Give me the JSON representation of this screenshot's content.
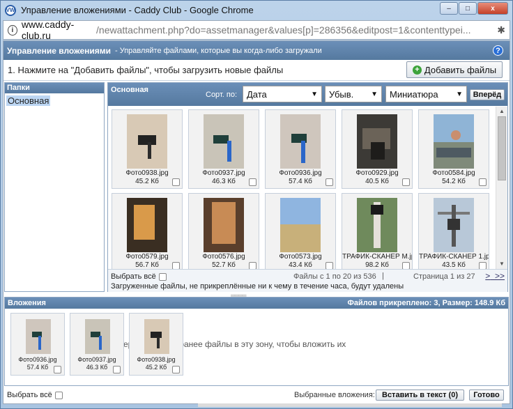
{
  "window": {
    "title": "Управление вложениями - Caddy Club - Google Chrome",
    "minimize": "–",
    "maximize": "□",
    "close": "x"
  },
  "address": {
    "host": "www.caddy-club.ru",
    "path": "/newattachment.php?do=assetmanager&values[p]=286356&editpost=1&contenttypei..."
  },
  "header": {
    "title": "Управление вложениями",
    "subtitle": "- Управляйте файлами, которые вы когда-либо загружали",
    "help": "?"
  },
  "instruction": "1. Нажмите на \"Добавить файлы\", чтобы загрузить новые файлы",
  "add_button": "Добавить файлы",
  "folders": {
    "heading": "Папки",
    "items": [
      "Основная"
    ]
  },
  "main": {
    "title": "Основная",
    "sort_label": "Сорт. по:",
    "sort_field": "Дата",
    "sort_order": "Убыв.",
    "view": "Миниатюра",
    "go": "Вперёд"
  },
  "files": [
    {
      "name": "Фото0938.jpg",
      "size": "45.2 Кб"
    },
    {
      "name": "Фото0937.jpg",
      "size": "46.3 Кб"
    },
    {
      "name": "Фото0936.jpg",
      "size": "57.4 Кб"
    },
    {
      "name": "Фото0929.jpg",
      "size": "40.5 Кб"
    },
    {
      "name": "Фото0584.jpg",
      "size": "54.2 Кб"
    },
    {
      "name": "Фото0579.jpg",
      "size": "56.7 Кб"
    },
    {
      "name": "Фото0576.jpg",
      "size": "52.7 Кб"
    },
    {
      "name": "Фото0573.jpg",
      "size": "43.4 Кб"
    },
    {
      "name": "ТРАФИК-СКАНЕР М.jp",
      "size": "98.2 Кб"
    },
    {
      "name": "ТРАФИК-СКАНЕР 1.jp",
      "size": "43.5 Кб"
    }
  ],
  "footer": {
    "select_all": "Выбрать всё",
    "range": "Файлы с 1 по 20 из 536",
    "separator": "|",
    "page": "Страница 1 из 27",
    "next": ">",
    "last": ">>",
    "notice": "Загруженные файлы, не прикреплённые ни к чему в течение часа, будут удалены"
  },
  "attachments": {
    "heading": "Вложения",
    "counts": "Файлов прикреплено: 3, Размер: 148.9 Кб",
    "drop_hint": "ер                    груженные ранее файлы в эту зону, чтобы вложить их",
    "items": [
      {
        "name": "Фото0936.jpg",
        "size": "57.4 Кб"
      },
      {
        "name": "Фото0937.jpg",
        "size": "46.3 Кб"
      },
      {
        "name": "Фото0938.jpg",
        "size": "45.2 Кб"
      }
    ]
  },
  "bottom": {
    "select_all": "Выбрать всё",
    "selected_label": "Выбранные вложения:",
    "insert": "Вставить в текст (0)",
    "done": "Готово"
  },
  "colors": {
    "header_blue": "#5f84ad",
    "thumb_bg": "#f2f2f2"
  }
}
